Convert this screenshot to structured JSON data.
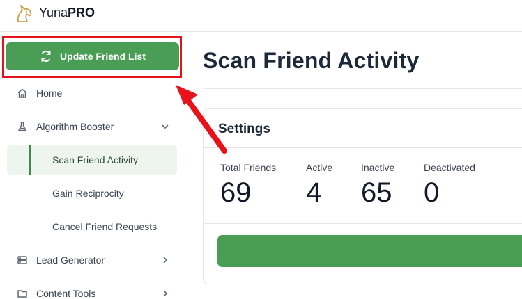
{
  "brand": {
    "name_regular": "Yuna",
    "name_bold": "PRO",
    "logo_icon": "unicorn-logo-icon"
  },
  "sidebar": {
    "update_button": {
      "label": "Update Friend List",
      "icon": "refresh-icon",
      "color": "#4a9d55"
    },
    "items": [
      {
        "label": "Home",
        "icon": "home-icon"
      },
      {
        "label": "Algorithm Booster",
        "icon": "flask-icon",
        "expanded": true
      },
      {
        "label": "Lead Generator",
        "icon": "server-icon"
      },
      {
        "label": "Content Tools",
        "icon": "folder-icon"
      }
    ],
    "sub_items": [
      {
        "label": "Scan Friend Activity",
        "active": true
      },
      {
        "label": "Gain Reciprocity"
      },
      {
        "label": "Cancel Friend Requests"
      }
    ]
  },
  "main": {
    "title": "Scan Friend Activity",
    "settings": {
      "title": "Settings",
      "stats": [
        {
          "label": "Total Friends",
          "value": "69"
        },
        {
          "label": "Active",
          "value": "4"
        },
        {
          "label": "Inactive",
          "value": "65"
        },
        {
          "label": "Deactivated",
          "value": "0"
        }
      ]
    }
  },
  "colors": {
    "accent": "#4a9d55",
    "highlight": "#e8121b",
    "active_bg": "#eef5ef"
  }
}
